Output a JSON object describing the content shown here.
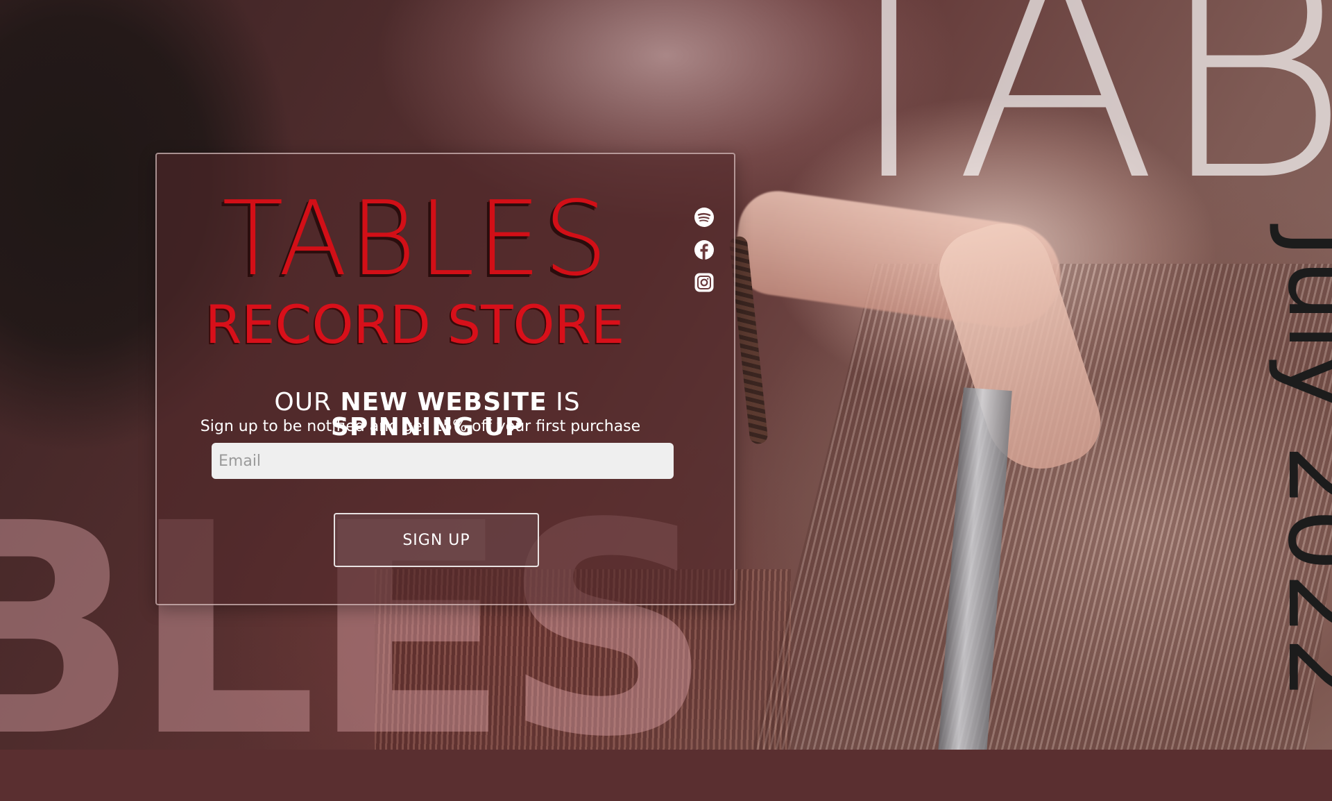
{
  "background": {
    "big_top_text": "TAB",
    "big_bottom_text": "BLES",
    "vertical_date": "July 2022"
  },
  "card": {
    "logo_title": "TABLES",
    "logo_subtitle": "RECORD STORE",
    "headline": {
      "w1": "OUR ",
      "w2": "NEW WEBSITE",
      "w3": " IS ",
      "w4": "SPINNING UP"
    },
    "subline": "Sign up to be notified and get 15% off your first purchase",
    "email_placeholder": "Email",
    "signup_label": "SIGN UP",
    "socials": [
      {
        "icon": "spotify-icon"
      },
      {
        "icon": "facebook-icon"
      },
      {
        "icon": "instagram-icon"
      }
    ]
  },
  "colors": {
    "brand_red": "#d20f17",
    "card_bg": "#50282a",
    "input_bg": "#efefef"
  }
}
